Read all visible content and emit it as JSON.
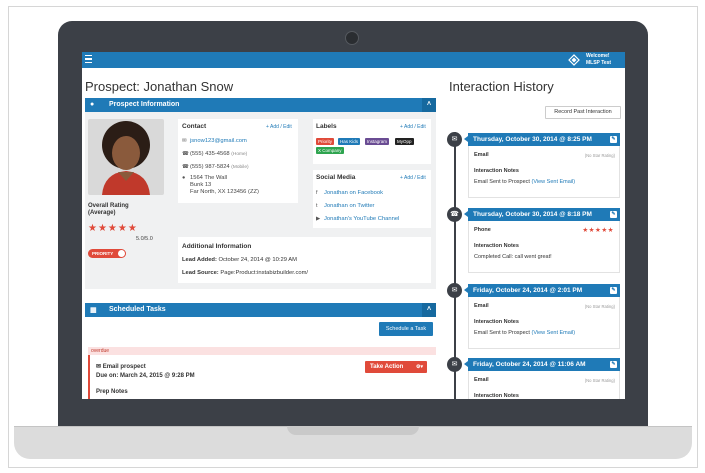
{
  "header": {
    "welcome_line1": "Welcome!",
    "welcome_line2": "MLSP Test"
  },
  "prospect": {
    "title": "Prospect: Jonathan Snow",
    "panel_title": "Prospect Information",
    "rating_label_line1": "Overall Rating",
    "rating_label_line2": "(Average)",
    "rating_stars": "★★★★★",
    "rating_score": "5.0/5.0",
    "priority_toggle": "PRIORITY"
  },
  "contact": {
    "title": "Contact",
    "add_edit": "Add / Edit",
    "email": "jsnow123@gmail.com",
    "phone_home": "(555) 435-4568",
    "phone_home_type": "(Home)",
    "phone_mobile": "(555) 987-5824",
    "phone_mobile_type": "(Mobile)",
    "address_line1": "1564 The Wall",
    "address_line2": "Bunk 13",
    "address_line3": "Far North, XX 123456",
    "address_tag": "(ZZ)"
  },
  "labels": {
    "title": "Labels",
    "add_edit": "Add / Edit",
    "items": [
      {
        "text": "Priority",
        "color": "#e04a3a"
      },
      {
        "text": "Has Kids",
        "color": "#1f7ab7"
      },
      {
        "text": "Instagram",
        "color": "#6a4c93"
      },
      {
        "text": "MyOpp",
        "color": "#222222"
      },
      {
        "text": "X Company",
        "color": "#2ea44f"
      }
    ]
  },
  "social": {
    "title": "Social Media",
    "add_edit": "Add / Edit",
    "facebook": "Jonathan on Facebook",
    "twitter": "Jonathan on Twitter",
    "youtube": "Jonathan's YouTube Channel"
  },
  "additional": {
    "title": "Additional Information",
    "lead_added_label": "Lead Added:",
    "lead_added_value": "October 24, 2014 @ 10:29 AM",
    "lead_source_label": "Lead Source:",
    "lead_source_value": "Page:Product:instabizbuilder.com/"
  },
  "tasks": {
    "panel_title": "Scheduled Tasks",
    "schedule_button": "Schedule a Task",
    "overdue": "overdue",
    "task_type": "Email prospect",
    "due_label": "Due on:",
    "due_value": "March 24, 2015 @ 9:28 PM",
    "take_action": "Take Action",
    "prep_notes": "Prep Notes"
  },
  "history": {
    "title": "Interaction History",
    "record_button": "Record Past Interaction",
    "entries": [
      {
        "icon": "envelope",
        "date": "Thursday, October 30, 2014 @ 8:25 PM",
        "type": "Email",
        "rating": "(No Star Rating)",
        "notes_label": "Interaction Notes",
        "notes": "Email Sent to Prospect",
        "link": "(View Sent Email)"
      },
      {
        "icon": "phone",
        "date": "Thursday, October 30, 2014 @ 8:18 PM",
        "type": "Phone",
        "rating": "★★★★★",
        "notes_label": "Interaction Notes",
        "notes": "Completed Call: call went great!",
        "link": ""
      },
      {
        "icon": "envelope",
        "date": "Friday, October 24, 2014 @ 2:01 PM",
        "type": "Email",
        "rating": "(No Star Rating)",
        "notes_label": "Interaction Notes",
        "notes": "Email Sent to Prospect",
        "link": "(View Sent Email)"
      },
      {
        "icon": "envelope",
        "date": "Friday, October 24, 2014 @ 11:06 AM",
        "type": "Email",
        "rating": "(No Star Rating)",
        "notes_label": "Interaction Notes",
        "notes": "",
        "link": ""
      }
    ]
  }
}
